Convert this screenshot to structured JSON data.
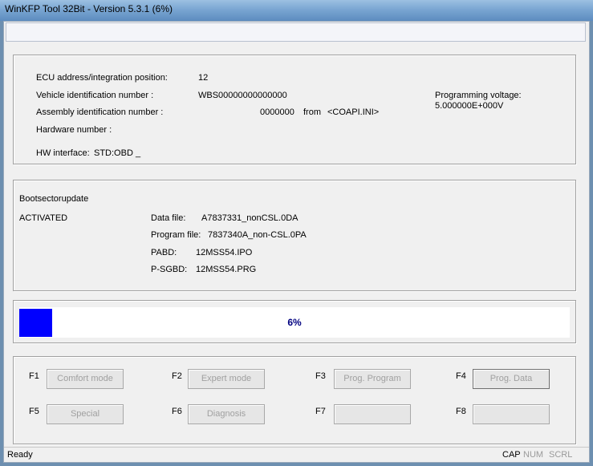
{
  "window": {
    "title": "WinKFP Tool 32Bit - Version 5.3.1 (6%)"
  },
  "ecu_info": {
    "ecu_address_label": "ECU address/integration position:",
    "ecu_address_value": "12",
    "vin_label": "Vehicle identification number :",
    "vin_value": "WBS00000000000000",
    "assembly_label": "Assembly identification number :",
    "assembly_value": "0000000",
    "assembly_from": "from",
    "assembly_source": "<COAPI.INI>",
    "hardware_label": "Hardware number :",
    "hw_interface_label": "HW interface:",
    "hw_interface_value": "STD:OBD _",
    "prog_voltage_label": "Programming voltage:",
    "prog_voltage_value": "5.000000E+000V"
  },
  "job": {
    "title": "Bootsectorupdate",
    "status": "ACTIVATED",
    "data_file_label": "Data file:",
    "data_file_value": "A7837331_nonCSL.0DA",
    "program_file_label": "Program file:",
    "program_file_value": "7837340A_non-CSL.0PA",
    "pabd_label": "PABD:",
    "pabd_value": "12MSS54.IPO",
    "psgbd_label": "P-SGBD:",
    "psgbd_value": "12MSS54.PRG"
  },
  "progress": {
    "percent_label": "6%",
    "fraction": 0.06
  },
  "fkeys": {
    "f1": {
      "key": "F1",
      "label": "Comfort mode"
    },
    "f2": {
      "key": "F2",
      "label": "Expert mode"
    },
    "f3": {
      "key": "F3",
      "label": "Prog. Program"
    },
    "f4": {
      "key": "F4",
      "label": "Prog. Data"
    },
    "f5": {
      "key": "F5",
      "label": "Special"
    },
    "f6": {
      "key": "F6",
      "label": "Diagnosis"
    },
    "f7": {
      "key": "F7",
      "label": ""
    },
    "f8": {
      "key": "F8",
      "label": ""
    }
  },
  "statusbar": {
    "status": "Ready",
    "cap": "CAP",
    "num": "NUM",
    "scrl": "SCRL"
  }
}
